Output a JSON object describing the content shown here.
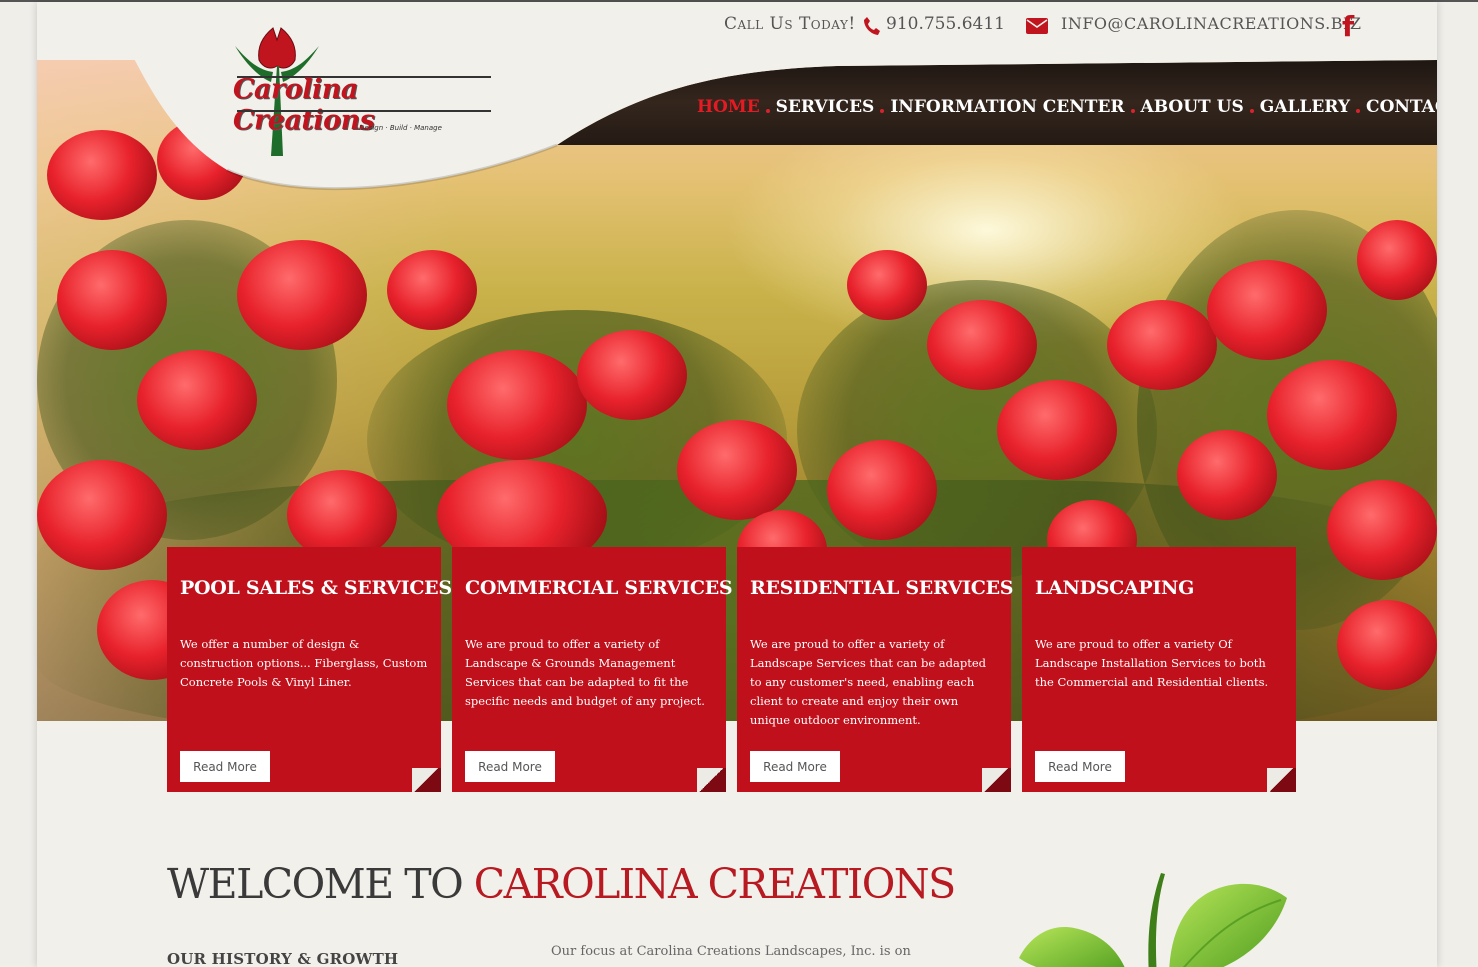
{
  "header": {
    "logo": {
      "name": "Carolina Creations",
      "tagline": "Design · Build · Manage"
    },
    "call_label": "Call Us Today!",
    "phone": "910.755.6411",
    "email": "INFO@CAROLINACREATIONS.BIZ",
    "social": "f"
  },
  "nav": {
    "items": [
      {
        "label": "HOME",
        "active": true
      },
      {
        "label": "SERVICES"
      },
      {
        "label": "INFORMATION CENTER"
      },
      {
        "label": "ABOUT US"
      },
      {
        "label": "GALLERY"
      },
      {
        "label": "CONTACT"
      }
    ]
  },
  "cards": [
    {
      "title": "POOL SALES & SERVICES",
      "text": "We offer a number of design & construction options... Fiberglass, Custom Concrete Pools & Vinyl Liner.",
      "button": "Read More"
    },
    {
      "title": "COMMERCIAL SERVICES",
      "text": "We are proud to offer a variety of Landscape & Grounds Management Services that can be adapted to fit the specific needs and budget of any project.",
      "button": "Read More"
    },
    {
      "title": "RESIDENTIAL SERVICES",
      "text": "We are proud to offer a variety of Landscape Services that can be adapted to any customer's need, enabling each client to create and enjoy their own unique outdoor environment.",
      "button": "Read More"
    },
    {
      "title": "LANDSCAPING",
      "text": "We are proud to offer a variety Of Landscape Installation Services to both the Commercial and Residential clients.",
      "button": "Read More"
    }
  ],
  "welcome": {
    "part1": "WELCOME TO ",
    "part2": "CAROLINA CREATIONS",
    "history_heading": "OUR HISTORY & GROWTH",
    "focus_text": "Our focus at Carolina Creations Landscapes, Inc. is on"
  },
  "colors": {
    "brand_red": "#c0101b",
    "nav_active": "#e51b24",
    "background": "#f2f0eb"
  }
}
